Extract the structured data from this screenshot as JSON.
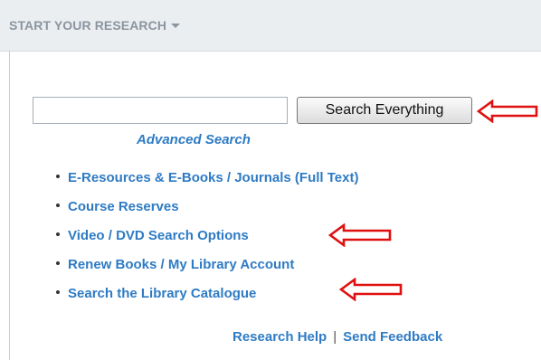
{
  "header": {
    "title": "START YOUR RESEARCH"
  },
  "search": {
    "value": "",
    "placeholder": "",
    "button_label": "Search Everything"
  },
  "advanced_search": {
    "label": "Advanced Search"
  },
  "links": [
    {
      "label": "E-Resources & E-Books / Journals (Full Text)"
    },
    {
      "label": "Course Reserves"
    },
    {
      "label": "Video / DVD Search Options"
    },
    {
      "label": "Renew Books / My Library Account"
    },
    {
      "label": "Search the Library Catalogue"
    }
  ],
  "footer": {
    "research_help": "Research Help",
    "separator": "|",
    "send_feedback": "Send Feedback"
  },
  "annotations": {
    "arrow_color": "#e01010"
  }
}
